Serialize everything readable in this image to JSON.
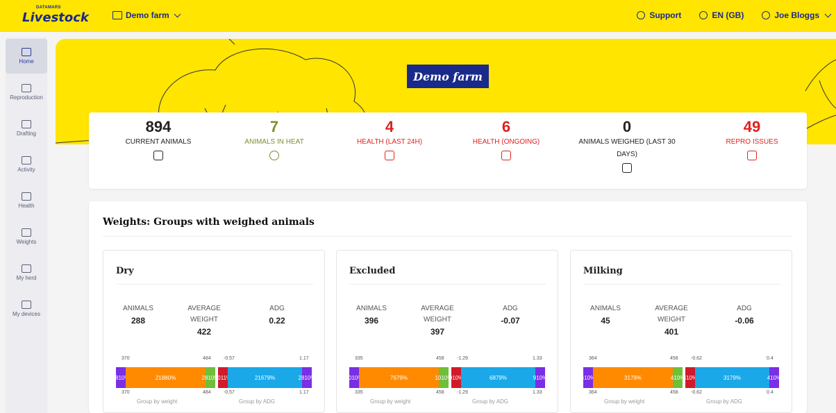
{
  "header": {
    "logo_small": "DATAMARS",
    "logo_big": "Livestock",
    "farm_selector": "Demo farm",
    "support": "Support",
    "language": "EN (GB)",
    "user": "Joe Bloggs"
  },
  "sidebar": {
    "items": [
      {
        "label": "Home",
        "icon": "home-icon"
      },
      {
        "label": "Reproduction",
        "icon": "reproduction-icon"
      },
      {
        "label": "Drafting",
        "icon": "drafting-icon"
      },
      {
        "label": "Activity",
        "icon": "activity-icon"
      },
      {
        "label": "Health",
        "icon": "health-icon"
      },
      {
        "label": "Weights",
        "icon": "weights-icon"
      },
      {
        "label": "My herd",
        "icon": "herd-icon"
      },
      {
        "label": "My devices",
        "icon": "devices-icon"
      }
    ]
  },
  "hero": {
    "farm_name": "Demo farm"
  },
  "stats": [
    {
      "value": "894",
      "label": "CURRENT ANIMALS",
      "color": "#222222",
      "icon": "cow-icon"
    },
    {
      "value": "7",
      "label": "ANIMALS IN HEAT",
      "color": "#7a8f2e",
      "icon": "heat-icon"
    },
    {
      "value": "4",
      "label": "HEALTH (LAST 24H)",
      "color": "#e02020",
      "icon": "medkit-icon"
    },
    {
      "value": "6",
      "label": "HEALTH (ONGOING)",
      "color": "#e02020",
      "icon": "medkit-icon"
    },
    {
      "value": "0",
      "label": "ANIMALS WEIGHED (LAST 30 DAYS)",
      "color": "#222222",
      "icon": "scale-icon"
    },
    {
      "value": "49",
      "label": "REPRO ISSUES",
      "color": "#e02020",
      "icon": "calendar-alert-icon"
    }
  ],
  "weights": {
    "title": "Weights: Groups with weighed animals",
    "labels": {
      "animals": "ANIMALS",
      "avg_weight": "AVERAGE WEIGHT",
      "adg": "ADG",
      "group_by_weight": "Group by weight",
      "group_by_adg": "Group by ADG"
    },
    "groups": [
      {
        "name": "Dry",
        "animals": "288",
        "avg_weight": "422",
        "adg": "0.22",
        "weight_bar": {
          "low_tick": "370",
          "high_tick": "484",
          "segments": [
            {
              "count": "28",
              "pct": "10%"
            },
            {
              "count": "218",
              "pct": "80%"
            },
            {
              "count": "28",
              "pct": "10%"
            }
          ]
        },
        "adg_bar": {
          "low_tick": "-0.57",
          "high_tick": "1.17",
          "segments": [
            {
              "count": "30",
              "pct": "11%"
            },
            {
              "count": "216",
              "pct": "79%"
            },
            {
              "count": "28",
              "pct": "10%"
            }
          ]
        }
      },
      {
        "name": "Excluded",
        "animals": "396",
        "avg_weight": "397",
        "adg": "-0.07",
        "weight_bar": {
          "low_tick": "335",
          "high_tick": "458",
          "segments": [
            {
              "count": "10",
              "pct": "10%"
            },
            {
              "count": "76",
              "pct": "79%"
            },
            {
              "count": "10",
              "pct": "10%"
            }
          ]
        },
        "adg_bar": {
          "low_tick": "-1.29",
          "high_tick": "1.33",
          "segments": [
            {
              "count": "9",
              "pct": "10%"
            },
            {
              "count": "68",
              "pct": "79%"
            },
            {
              "count": "9",
              "pct": "10%"
            }
          ]
        }
      },
      {
        "name": "Milking",
        "animals": "45",
        "avg_weight": "401",
        "adg": "-0.06",
        "weight_bar": {
          "low_tick": "364",
          "high_tick": "458",
          "segments": [
            {
              "count": "4",
              "pct": "10%"
            },
            {
              "count": "31",
              "pct": "79%"
            },
            {
              "count": "4",
              "pct": "10%"
            }
          ]
        },
        "adg_bar": {
          "low_tick": "-0.62",
          "high_tick": "0.4",
          "segments": [
            {
              "count": "4",
              "pct": "10%"
            },
            {
              "count": "31",
              "pct": "79%"
            },
            {
              "count": "4",
              "pct": "10%"
            }
          ]
        }
      }
    ]
  },
  "colors": {
    "brand_yellow": "#ffe500",
    "brand_navy": "#1a2a8a",
    "alert_red": "#e02020",
    "heat_green": "#7a8f2e",
    "bar_purple": "#7a2ee6",
    "bar_orange": "#ff8a00",
    "bar_green": "#6fbf3a",
    "bar_red": "#d11a2a",
    "bar_blue": "#1aa8e8"
  }
}
